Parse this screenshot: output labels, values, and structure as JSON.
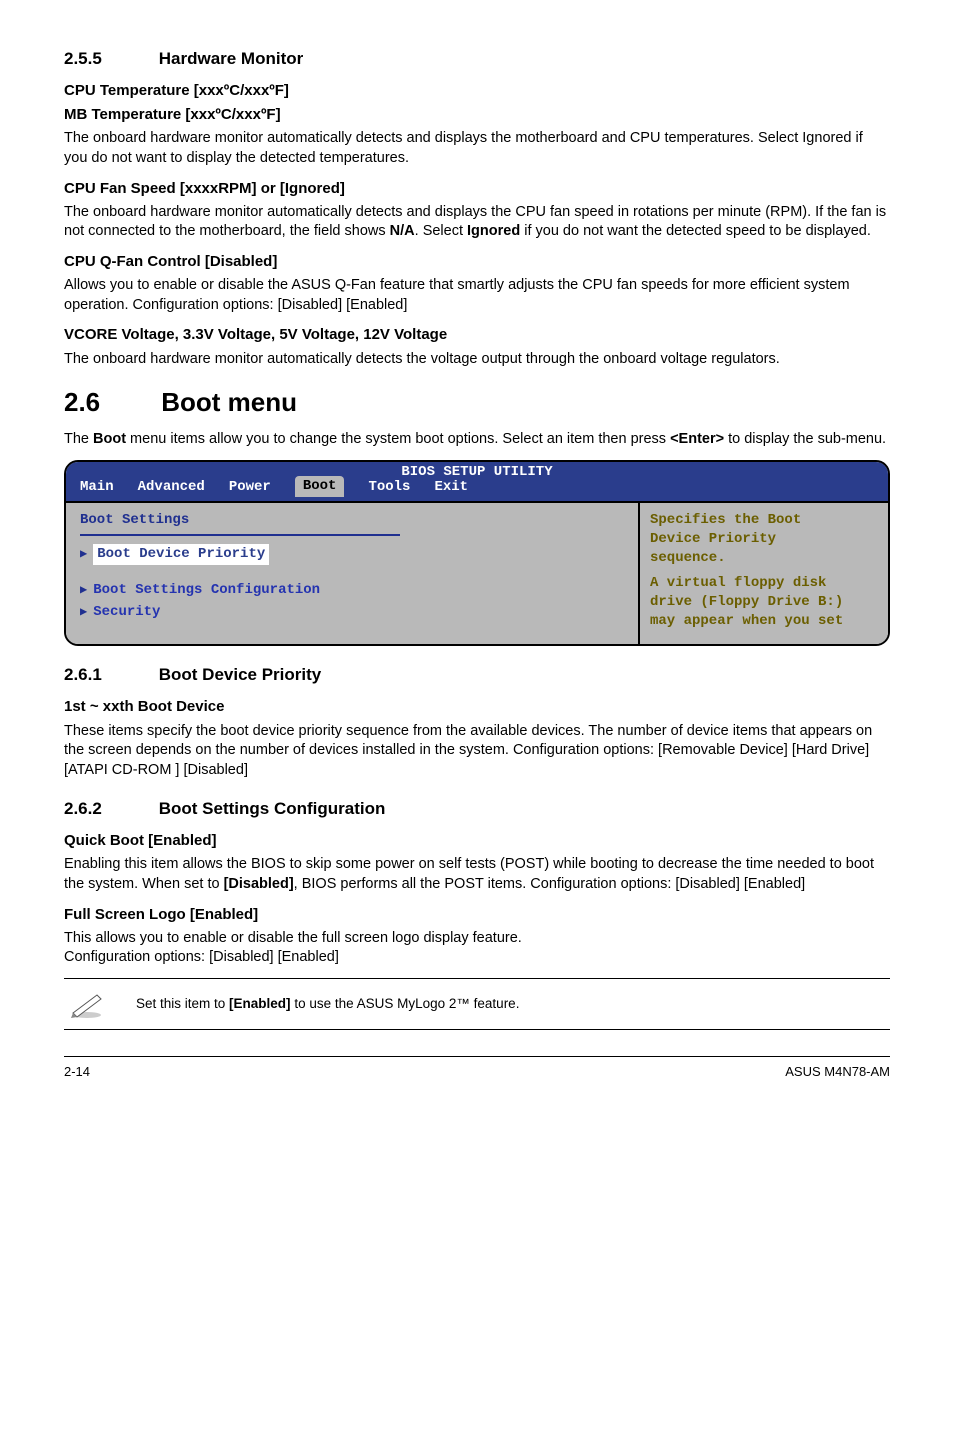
{
  "s255": {
    "num": "2.5.5",
    "title": "Hardware Monitor",
    "h1a": "CPU Temperature [xxxºC/xxxºF]",
    "h1b": "MB Temperature [xxxºC/xxxºF]",
    "p1": "The onboard hardware monitor automatically detects and displays the motherboard and CPU temperatures. Select Ignored if you do not want to display the detected temperatures.",
    "h2": "CPU Fan Speed [xxxxRPM] or [Ignored]",
    "p2a": "The onboard hardware monitor automatically detects and displays the CPU fan speed in rotations per minute (RPM). If the fan is not connected to the motherboard, the field shows ",
    "p2b": "N/A",
    "p2c": ". Select ",
    "p2d": "Ignored",
    "p2e": " if you do not want the detected speed to be displayed.",
    "h3": "CPU Q-Fan Control [Disabled]",
    "p3": "Allows you to enable or disable the ASUS Q-Fan feature that smartly adjusts the CPU fan speeds for more efficient system operation. Configuration options: [Disabled] [Enabled]",
    "h4": "VCORE Voltage, 3.3V Voltage, 5V Voltage, 12V Voltage",
    "p4": "The onboard hardware monitor automatically detects the voltage output through the onboard voltage regulators."
  },
  "s26": {
    "num": "2.6",
    "title": "Boot menu",
    "p_a": "The ",
    "p_b": "Boot",
    "p_c": " menu items allow you to change the system boot options. Select an item then press ",
    "p_d": "<Enter>",
    "p_e": " to display the sub-menu."
  },
  "bios": {
    "title": "BIOS SETUP UTILITY",
    "tabs": {
      "main": "Main",
      "advanced": "Advanced",
      "power": "Power",
      "boot": "Boot",
      "tools": "Tools",
      "exit": "Exit"
    },
    "left": {
      "heading": "Boot Settings",
      "item1": "Boot Device Priority",
      "item2": "Boot Settings Configuration",
      "item3": "Security"
    },
    "right": {
      "l1": "Specifies the Boot",
      "l2": "Device Priority",
      "l3": "sequence.",
      "l4": "A virtual floppy disk",
      "l5": "drive (Floppy Drive B:)",
      "l6": "may appear when you set"
    }
  },
  "s261": {
    "num": "2.6.1",
    "title": "Boot Device Priority",
    "h": "1st ~ xxth Boot Device",
    "p": "These items specify the boot device priority sequence from the available devices. The number of device items that appears on the screen depends on the number of devices installed in the system. Configuration options: [Removable Device] [Hard Drive]\n[ATAPI CD-ROM ] [Disabled]"
  },
  "s262": {
    "num": "2.6.2",
    "title": "Boot Settings Configuration",
    "h1": "Quick Boot [Enabled]",
    "p1a": "Enabling this item allows the BIOS to skip some power on self tests (POST) while booting to decrease the time needed to boot the system. When set to ",
    "p1b": "[Disabled]",
    "p1c": ", BIOS performs all the POST items. Configuration options: [Disabled] [Enabled]",
    "h2": "Full Screen Logo [Enabled]",
    "p2": "This allows you to enable or disable the full screen logo display feature.\nConfiguration options: [Disabled] [Enabled]"
  },
  "note": {
    "a": "Set this item to ",
    "b": "[Enabled]",
    "c": " to use the ASUS MyLogo 2™ feature."
  },
  "footer": {
    "left": "2-14",
    "right": "ASUS M4N78-AM"
  }
}
